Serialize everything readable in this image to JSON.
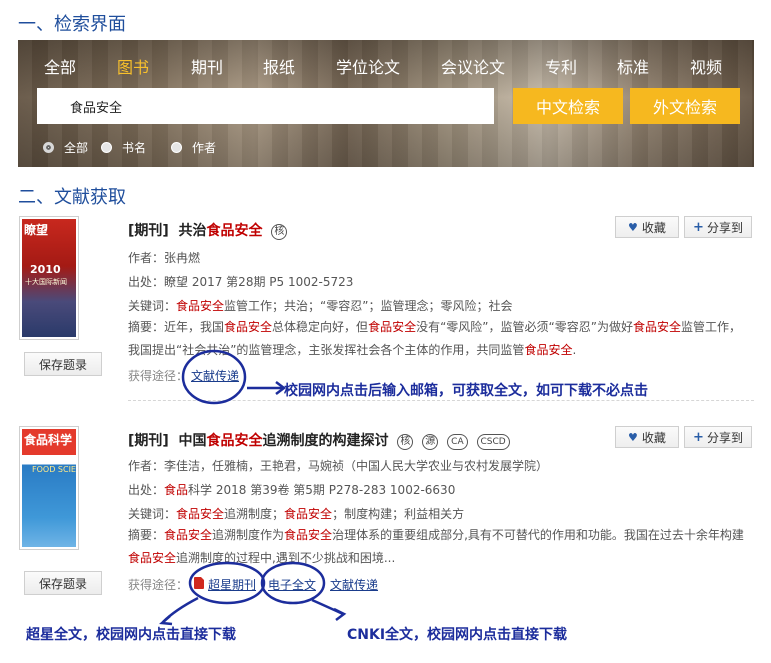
{
  "sections": {
    "search_title": "一、检索界面",
    "results_title": "二、文献获取"
  },
  "search": {
    "tabs": [
      {
        "label": "全部",
        "active": false
      },
      {
        "label": "图书",
        "active": true
      },
      {
        "label": "期刊",
        "active": false
      },
      {
        "label": "报纸",
        "active": false
      },
      {
        "label": "学位论文",
        "active": false
      },
      {
        "label": "会议论文",
        "active": false
      },
      {
        "label": "专利",
        "active": false
      },
      {
        "label": "标准",
        "active": false
      },
      {
        "label": "视频",
        "active": false
      }
    ],
    "query": "食品安全",
    "btn_chinese": "中文检索",
    "btn_foreign": "外文检索",
    "scopes": [
      {
        "label": "全部",
        "checked": true
      },
      {
        "label": "书名",
        "checked": false
      },
      {
        "label": "作者",
        "checked": false
      }
    ],
    "colors": {
      "accent": "#f6b81f",
      "active_tab": "#f8c02c"
    }
  },
  "results": [
    {
      "cover_title": "瞭望",
      "cover_year": "2010",
      "cover_subtitle": "十大国际新闻",
      "save_label": "保存题录",
      "type": "[期刊]",
      "title_pre": "共治",
      "title_hl": "食品安全",
      "title_post": "",
      "badges": [
        "核"
      ],
      "author_label": "作者：",
      "author": "张冉燃",
      "source_label": "出处：",
      "source": "瞭望 2017 第28期 P5  1002-5723",
      "keywords_label": "关键词：",
      "keywords_hl": "食品安全",
      "keywords_rest": "监管工作；共治；“零容忍”；监管理念；零风险；社会",
      "abstract_label": "摘要：",
      "abstract_segments": [
        {
          "t": "近年，我国",
          "hl": false
        },
        {
          "t": "食品安全",
          "hl": true
        },
        {
          "t": "总体稳定向好，但",
          "hl": false
        },
        {
          "t": "食品安全",
          "hl": true
        },
        {
          "t": "没有“零风险”，监管必须“零容忍”为做好",
          "hl": false
        },
        {
          "t": "食品安全",
          "hl": true
        },
        {
          "t": "监管工作，我国提出“社会共治”的监管理念，主张发挥社会各个主体的作用，共同监管",
          "hl": false
        },
        {
          "t": "食品安全",
          "hl": true
        },
        {
          "t": ".",
          "hl": false
        }
      ],
      "fav_label": "收藏",
      "share_label": "分享到",
      "route_label": "获得途径：",
      "links": [
        "文献传递"
      ]
    },
    {
      "cover_title": "食品科学",
      "cover_year": "",
      "cover_subtitle": "FOOD SCIENCE",
      "save_label": "保存题录",
      "type": "[期刊]",
      "title_pre": "中国",
      "title_hl": "食品安全",
      "title_post": "追溯制度的构建探讨",
      "badges": [
        "核",
        "源",
        "CA",
        "CSCD"
      ],
      "author_label": "作者：",
      "author": "李佳洁，任雅楠，王艳君，马婉祯（中国人民大学农业与农村发展学院）",
      "source_label": "出处：",
      "source_hl": "食品",
      "source": "科学 2018 第39卷 第5期 P278-283  1002-6630",
      "keywords_label": "关键词：",
      "keywords_segments": [
        {
          "t": "食品安全",
          "hl": true
        },
        {
          "t": "追溯制度；",
          "hl": false
        },
        {
          "t": "食品安全",
          "hl": true
        },
        {
          "t": "；制度构建；利益相关方",
          "hl": false
        }
      ],
      "abstract_label": "摘要：",
      "abstract_segments": [
        {
          "t": "食品安全",
          "hl": true
        },
        {
          "t": "追溯制度作为",
          "hl": false
        },
        {
          "t": "食品安全",
          "hl": true
        },
        {
          "t": "治理体系的重要组成部分,具有不可替代的作用和功能。我国在过去十余年构建",
          "hl": false
        },
        {
          "t": "食品安全",
          "hl": true
        },
        {
          "t": "追溯制度的过程中,遇到不少挑战和困境...",
          "hl": false
        }
      ],
      "fav_label": "收藏",
      "share_label": "分享到",
      "route_label": "获得途径：",
      "links": [
        "超星期刊",
        "电子全文",
        "文献传递"
      ]
    }
  ],
  "annotations": {
    "note1": "校园网内点击后输入邮箱，可获取全文，如可下载不必点击",
    "note2": "超星全文，校园网内点击直接下载",
    "note3": "CNKI全文，校园网内点击直接下载",
    "ink_color": "#1c2d9c"
  }
}
